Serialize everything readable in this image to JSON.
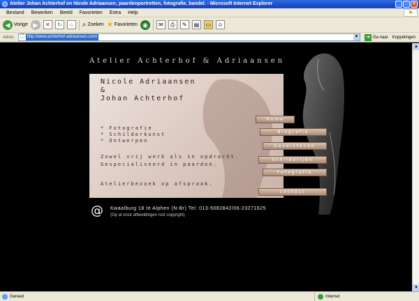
{
  "window": {
    "title": "Atelier Johan Achterhof en Nicole Adriaansen, paardenportretten, fotografie, bandel. - Microsoft Internet Explorer",
    "minimize": "_",
    "maximize": "□",
    "close": "×"
  },
  "menu": {
    "items": [
      "Bestand",
      "Bewerken",
      "Beeld",
      "Favorieten",
      "Extra",
      "Help"
    ]
  },
  "toolbar": {
    "back": "Vorige",
    "search": "Zoeken",
    "favorites": "Favorieten"
  },
  "address": {
    "label": "Adres",
    "url": "http://www.achterhof-adriaansen.com/",
    "go": "Ga naar",
    "links": "Koppelingen"
  },
  "site": {
    "title": "Atelier Achterhof & Adriaansen",
    "names": "Nicole Adriaansen\n&\nJohan Achterhof",
    "services": [
      "* Fotografie",
      "* Schilderkunst",
      "* Ontwerpen"
    ],
    "description": "Zowel vrij werk als in opdracht. Gespecialiseerd in paarden.",
    "visit": "Atelierbezoek op afspraak.",
    "nav": [
      "Home",
      "Biografie",
      "Gevelstenen",
      "Schilderijen",
      "Fotografie",
      "contact"
    ],
    "contact_symbol": "@",
    "address_line": "Kwaalburg 18 te Alphen (N-Br) Tel: 013-5082842/06-23271625",
    "copyright": "(Op al onze afbeeldingen rust copyright)"
  },
  "status": {
    "left": "Gereed",
    "zone": "Internet"
  }
}
